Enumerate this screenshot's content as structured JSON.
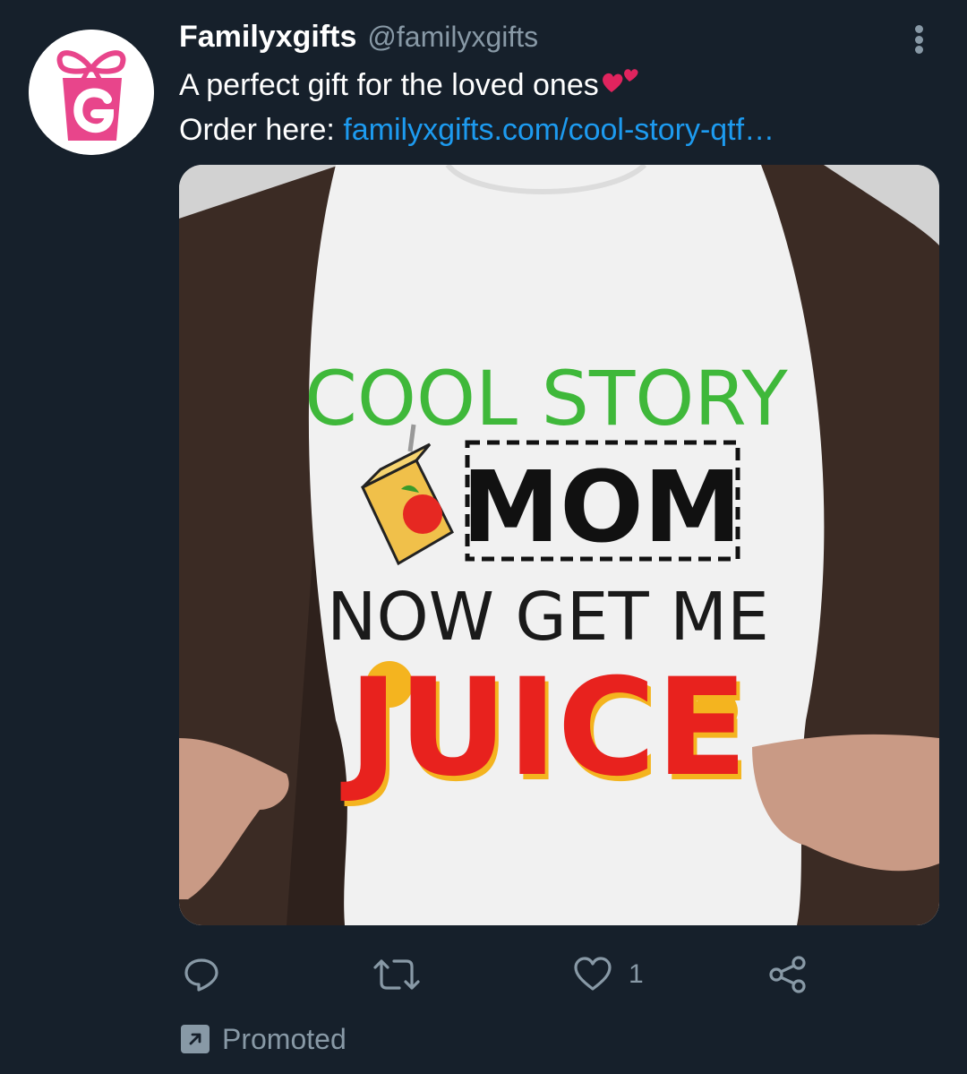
{
  "tweet": {
    "author": {
      "display_name": "Familyxgifts",
      "handle": "@familyxgifts"
    },
    "text_line1": "A perfect gift for the loved ones",
    "text_line2_prefix": "Order here: ",
    "link_text": "familyxgifts.com/cool-story-qtf…",
    "media": {
      "shirt_text": {
        "line1": "COOL STORY",
        "line2": "MOM",
        "line3": "NOW GET ME",
        "line4": "JUICE"
      }
    },
    "actions": {
      "reply_icon": "reply-icon",
      "retweet_icon": "retweet-icon",
      "like_icon": "heart-icon",
      "like_count": "1",
      "share_icon": "share-icon"
    },
    "promoted_label": "Promoted"
  },
  "colors": {
    "background": "#16202b",
    "text_primary": "#ffffff",
    "text_secondary": "#8899a6",
    "link": "#1d9bf0",
    "brand_pink": "#e8458b"
  }
}
